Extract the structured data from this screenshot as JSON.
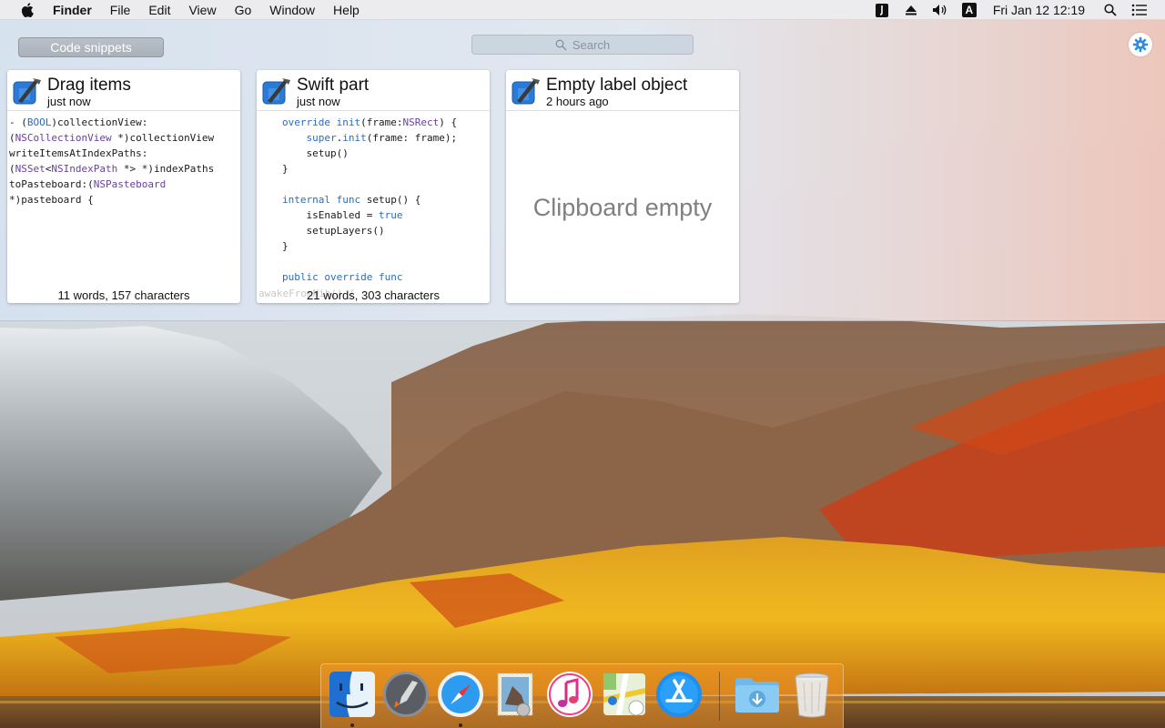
{
  "menubar": {
    "app_name": "Finder",
    "menus": [
      "File",
      "Edit",
      "View",
      "Go",
      "Window",
      "Help"
    ],
    "clock": "Fri Jan 12  12:19",
    "status_icons": [
      "clipboard-app-icon",
      "eject-icon",
      "volume-icon",
      "input-source-icon",
      "spotlight-icon",
      "notification-center-icon"
    ],
    "input_source_letter": "A"
  },
  "panel": {
    "collection_button": "Code snippets",
    "search_placeholder": "Search",
    "cards": [
      {
        "title": "Drag items",
        "time": "just now",
        "app_icon": "xcode-icon",
        "footer": "11 words, 157 characters"
      },
      {
        "title": "Swift part",
        "time": "just now",
        "app_icon": "xcode-icon",
        "footer": "21 words, 303 characters",
        "ghost_text": "awakeFromNib() {"
      },
      {
        "title": "Empty label object",
        "time": "2 hours ago",
        "app_icon": "xcode-icon",
        "empty_message": "Clipboard empty"
      }
    ]
  },
  "dock": {
    "items": [
      "finder-icon",
      "launchpad-icon",
      "safari-icon",
      "mail-icon",
      "itunes-icon",
      "maps-icon",
      "app-store-icon",
      "downloads-folder-icon",
      "trash-icon"
    ],
    "running": [
      "finder-icon",
      "safari-icon"
    ]
  },
  "colors": {
    "accent": "#2a6cc0",
    "code_keyword": "#2a6cc0",
    "code_type": "#6a3fa0",
    "empty_text": "#808080"
  }
}
